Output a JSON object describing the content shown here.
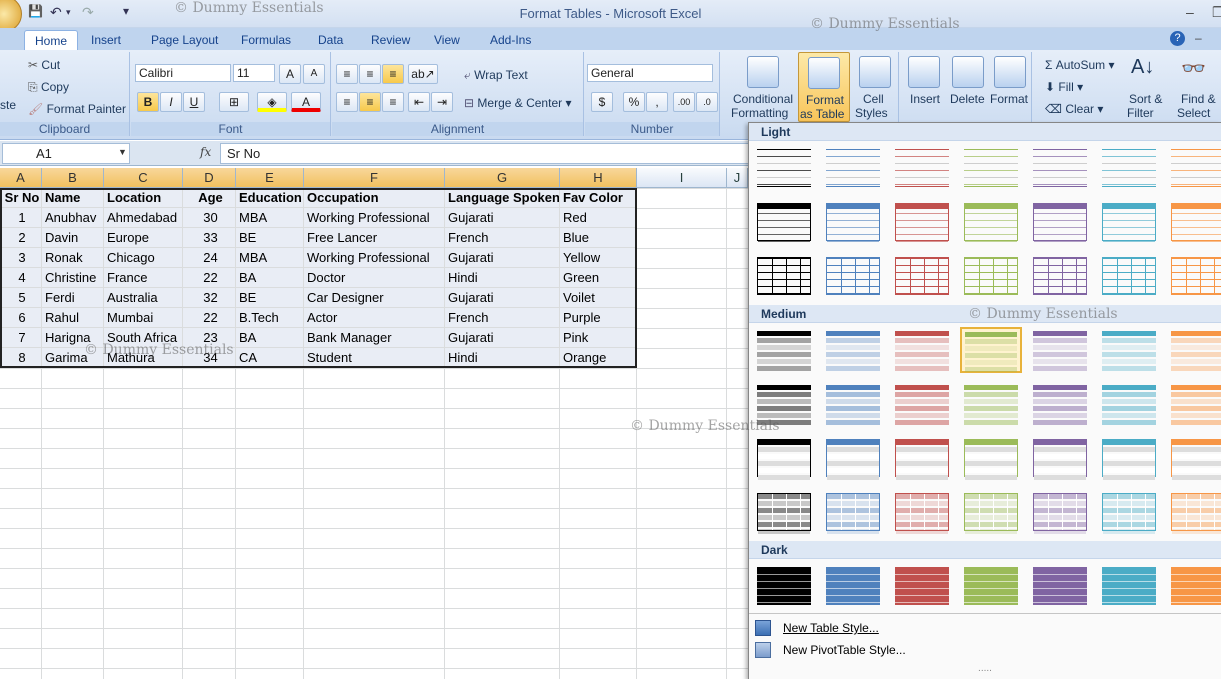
{
  "window": {
    "title": "Format Tables - Microsoft Excel"
  },
  "watermark": "© Dummy Essentials",
  "qat": {
    "customize": "▾"
  },
  "tabs": [
    "Home",
    "Insert",
    "Page Layout",
    "Formulas",
    "Data",
    "Review",
    "View",
    "Add-Ins"
  ],
  "ribbon": {
    "clipboard": {
      "label": "Clipboard",
      "paste": "ste",
      "cut": "Cut",
      "copy": "Copy",
      "format_painter": "Format Painter"
    },
    "font": {
      "label": "Font",
      "name": "Calibri",
      "size": "11",
      "bold": "B",
      "italic": "I",
      "underline": "U"
    },
    "alignment": {
      "label": "Alignment",
      "wrap": "Wrap Text",
      "merge": "Merge & Center"
    },
    "number": {
      "label": "Number",
      "format": "General",
      "currency": "$",
      "percent": "%",
      "comma": ","
    },
    "styles": {
      "conditional": [
        "Conditional",
        "Formatting"
      ],
      "format_table": [
        "Format",
        "as Table"
      ],
      "cell_styles": [
        "Cell",
        "Styles"
      ]
    },
    "cells": {
      "insert": "Insert",
      "delete": "Delete",
      "format": "Format"
    },
    "editing": {
      "autosum": "AutoSum",
      "fill": "Fill",
      "clear": "Clear",
      "sort": [
        "Sort &",
        "Filter"
      ],
      "find": [
        "Find &",
        "Select"
      ]
    }
  },
  "formula_bar": {
    "name_box": "A1",
    "fx": "fx",
    "value": "Sr No"
  },
  "columns": [
    "A",
    "B",
    "C",
    "D",
    "E",
    "F",
    "G",
    "H",
    "I",
    "J"
  ],
  "table": {
    "headers": [
      "Sr No",
      "Name",
      "Location",
      "Age",
      "Education",
      "Occupation",
      "Language Spoken",
      "Fav Color"
    ],
    "rows": [
      [
        "1",
        "Anubhav",
        "Ahmedabad",
        "30",
        "MBA",
        "Working Professional",
        "Gujarati",
        "Red"
      ],
      [
        "2",
        "Davin",
        "Europe",
        "33",
        "BE",
        "Free Lancer",
        "French",
        "Blue"
      ],
      [
        "3",
        "Ronak",
        "Chicago",
        "24",
        "MBA",
        "Working Professional",
        "Gujarati",
        "Yellow"
      ],
      [
        "4",
        "Christine",
        "France",
        "22",
        "BA",
        "Doctor",
        "Hindi",
        "Green"
      ],
      [
        "5",
        "Ferdi",
        "Australia",
        "32",
        "BE",
        "Car Designer",
        "Gujarati",
        "Voilet"
      ],
      [
        "6",
        "Rahul",
        "Mumbai",
        "22",
        "B.Tech",
        "Actor",
        "French",
        "Purple"
      ],
      [
        "7",
        "Harigna",
        "South Africa",
        "23",
        "BA",
        "Bank Manager",
        "Gujarati",
        "Pink"
      ],
      [
        "8",
        "Garima",
        "Mathura",
        "34",
        "CA",
        "Student",
        "Hindi",
        "Orange"
      ]
    ]
  },
  "gallery": {
    "sections": [
      "Light",
      "Medium",
      "Dark"
    ],
    "colors": [
      "#000000",
      "#4f81bd",
      "#c0504d",
      "#9bbb59",
      "#8064a2",
      "#4bacc6",
      "#f79646"
    ],
    "new_table_style": "New Table Style...",
    "new_pivot_style": "New PivotTable Style...",
    "more": "....."
  }
}
